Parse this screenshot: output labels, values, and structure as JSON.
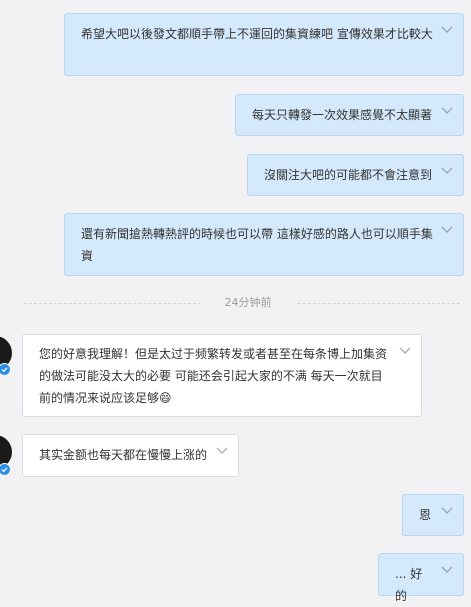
{
  "messages": [
    {
      "side": "out",
      "text": "希望大吧以後發文都順手帶上不運回的集資練吧 宣傳效果才比較大"
    },
    {
      "side": "out",
      "text": "每天只轉發一次效果感覺不太顯著"
    },
    {
      "side": "out",
      "text": "沒關注大吧的可能都不會注意到"
    },
    {
      "side": "out",
      "text": "還有新聞搶熱轉熱評的時候也可以帶 這樣好感的路人也可以順手集資"
    },
    {
      "side": "in",
      "text": "您的好意我理解！但是太过于频繁转发或者甚至在每条博上加集资的做法可能没太大的必要 可能还会引起大家的不满 每天一次就目前的情况来说应该足够😄"
    },
    {
      "side": "in",
      "text": "其实金额也每天都在慢慢上涨的"
    },
    {
      "side": "out",
      "text": "恩"
    },
    {
      "side": "out",
      "text": "... 好的"
    }
  ],
  "timestamp": "24分钟前",
  "icons": {
    "more": "chevron-down-icon",
    "badge": "verified-badge-icon"
  },
  "colors": {
    "outgoing_bubble": "#d4e9fb",
    "incoming_bubble": "#ffffff",
    "background": "#f2f2f5",
    "verified": "#2b8de6"
  }
}
